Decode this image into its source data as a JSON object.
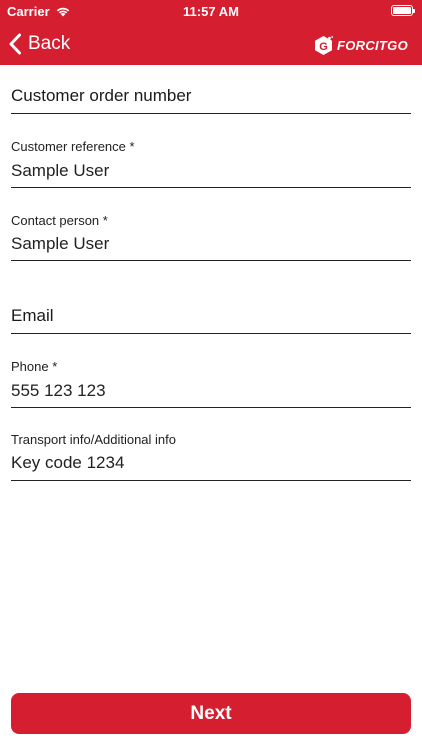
{
  "status_bar": {
    "carrier": "Carrier",
    "time": "11:57 AM"
  },
  "nav": {
    "back_label": "Back",
    "logo_text": "FORCITGO"
  },
  "form": {
    "customer_order_number": {
      "placeholder": "Customer order number",
      "value": ""
    },
    "customer_reference": {
      "label": "Customer reference *",
      "value": "Sample User"
    },
    "contact_person": {
      "label": "Contact person *",
      "value": "Sample User"
    },
    "email": {
      "placeholder": "Email",
      "value": ""
    },
    "phone": {
      "label": "Phone *",
      "value": "555 123 123"
    },
    "transport_info": {
      "label": "Transport info/Additional info",
      "value": "Key code 1234"
    }
  },
  "actions": {
    "next_label": "Next"
  },
  "colors": {
    "brand_red": "#d51e2f",
    "text": "#222222",
    "background": "#ffffff"
  },
  "icons": {
    "back": "chevron-left-icon",
    "wifi": "wifi-icon",
    "battery": "battery-icon",
    "logo": "forcitgo-logo-icon"
  }
}
